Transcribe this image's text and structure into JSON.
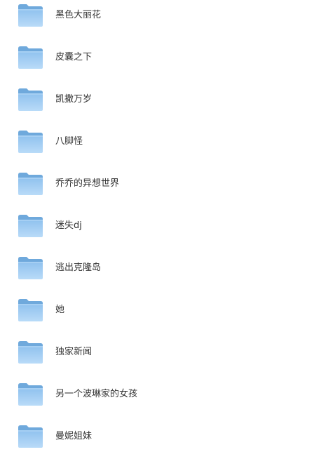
{
  "file_list": {
    "icon": "folder-icon",
    "colors": {
      "folder_back": "#6fa9dc",
      "folder_front_top": "#8fc1ee",
      "folder_front_bottom": "#b9dbf8",
      "text": "#333333"
    },
    "items": [
      {
        "name": "黑色大丽花"
      },
      {
        "name": "皮囊之下"
      },
      {
        "name": "凯撒万岁"
      },
      {
        "name": "八脚怪"
      },
      {
        "name": "乔乔的异想世界"
      },
      {
        "name": "迷失dj"
      },
      {
        "name": "逃出克隆岛"
      },
      {
        "name": "她"
      },
      {
        "name": "独家新闻"
      },
      {
        "name": "另一个波琳家的女孩"
      },
      {
        "name": "曼妮姐妹"
      }
    ]
  }
}
